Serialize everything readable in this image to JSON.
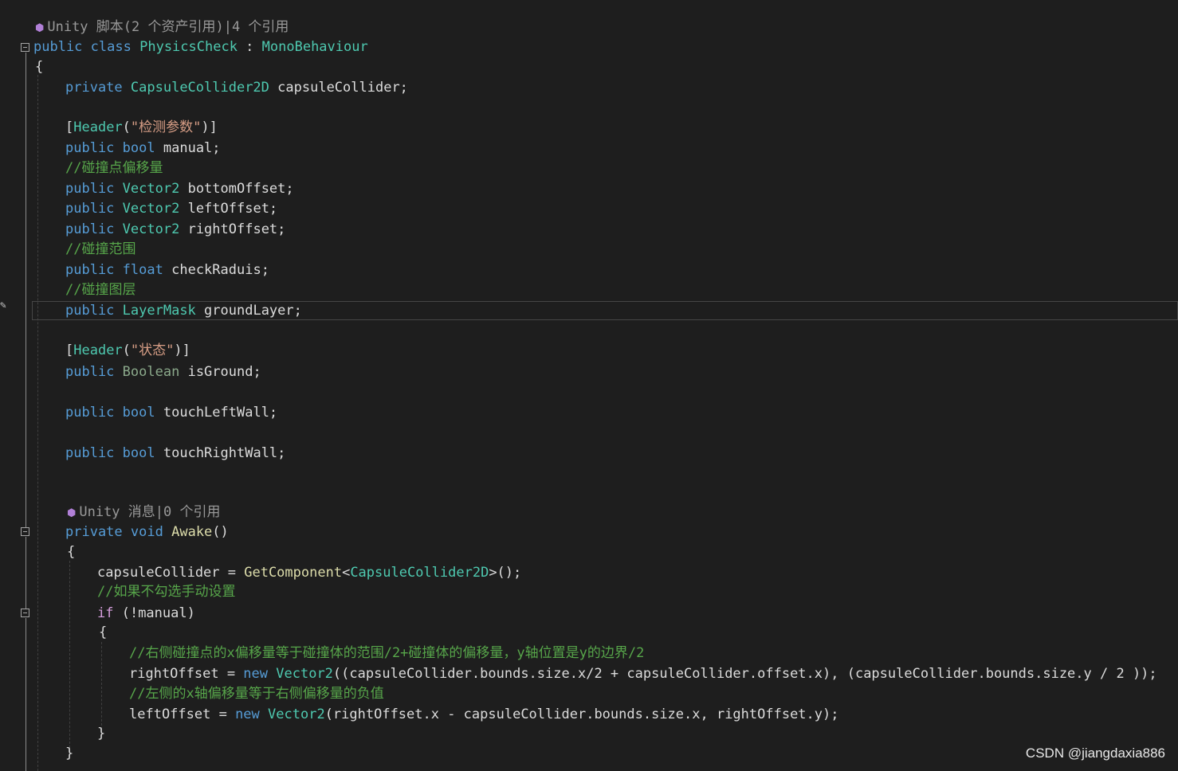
{
  "codelens": {
    "class_refs": "Unity 脚本(2 个资产引用)|4 个引用",
    "awake_refs": "Unity 消息|0 个引用"
  },
  "tokens": {
    "public": "public",
    "class": "class",
    "private": "private",
    "bool": "bool",
    "float": "float",
    "void": "void",
    "new": "new",
    "if": "if",
    "class_name": "PhysicsCheck",
    "colon": " : ",
    "mono": "MonoBehaviour",
    "capsule_type": "CapsuleCollider2D",
    "capsule_var": "capsuleCollider;",
    "header_attr": "Header",
    "header1_str": "\"检测参数\"",
    "header2_str": "\"状态\"",
    "vector2": "Vector2",
    "layermask": "LayerMask",
    "boolean": "Boolean",
    "manual": "manual;",
    "bottom": "bottomOffset;",
    "left": "leftOffset;",
    "right": "rightOffset;",
    "radius": "checkRaduis;",
    "ground": "groundLayer;",
    "is_ground": "isGround;",
    "touch_left": "touchLeftWall;",
    "touch_right": "touchRightWall;",
    "awake": "Awake",
    "getcomponent": "GetComponent"
  },
  "comments": {
    "c1": "//碰撞点偏移量",
    "c2": "//碰撞范围",
    "c3": "//碰撞图层",
    "c4": "//如果不勾选手动设置",
    "c5": "//右侧碰撞点的x偏移量等于碰撞体的范围/2+碰撞体的偏移量，y轴位置是y的边界/2",
    "c6": "//左侧的x轴偏移量等于右侧偏移量的负值"
  },
  "code": {
    "assign_capsule_pre": "capsuleCollider = ",
    "assign_right_pre": "rightOffset = ",
    "assign_right_args": "((capsuleCollider.bounds.size.x/2 + capsuleCollider.offset.x), (capsuleCollider.bounds.size.y / 2 ));",
    "assign_left_pre": "leftOffset = ",
    "assign_left_args": "(rightOffset.x - capsuleCollider.bounds.size.x, rightOffset.y);",
    "if_cond": " (!manual)"
  },
  "watermark": "CSDN @jiangdaxia886"
}
